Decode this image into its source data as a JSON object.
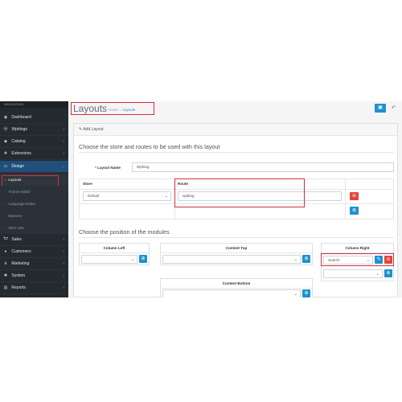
{
  "sidebar": {
    "header": "NAVIGATION",
    "items": [
      {
        "label": "Dashboard",
        "icon": "dashboard-icon",
        "glyph": "◉",
        "chev": ""
      },
      {
        "label": "Wpblogs",
        "icon": "wordpress-icon",
        "glyph": "Ⓦ",
        "chev": "›"
      },
      {
        "label": "Catalog",
        "icon": "tag-icon",
        "glyph": "◆",
        "chev": "›"
      },
      {
        "label": "Extensions",
        "icon": "puzzle-icon",
        "glyph": "✚",
        "chev": "›"
      },
      {
        "label": "Design",
        "icon": "monitor-icon",
        "glyph": "▭",
        "chev": "⌄"
      },
      {
        "label": "Sales",
        "icon": "cart-icon",
        "glyph": "🛒",
        "chev": "›"
      },
      {
        "label": "Customers",
        "icon": "user-icon",
        "glyph": "●",
        "chev": "›"
      },
      {
        "label": "Marketing",
        "icon": "share-icon",
        "glyph": "⋔",
        "chev": "›"
      },
      {
        "label": "System",
        "icon": "gear-icon",
        "glyph": "✱",
        "chev": "›"
      },
      {
        "label": "Reports",
        "icon": "bar-chart-icon",
        "glyph": "▥",
        "chev": "›"
      }
    ],
    "design_sub": [
      "Layouts",
      "Theme Editor",
      "Language Editor",
      "Banners",
      "SEO URL"
    ]
  },
  "page": {
    "title": "Layouts",
    "breadcrumb_home": "Home",
    "breadcrumb_sep": "›",
    "breadcrumb_current": "Layouts",
    "save_glyph": "▣",
    "back_glyph": "↶"
  },
  "panel": {
    "heading_glyph": "✎",
    "heading": "Add Layout",
    "section1": "Choose the store and routes to be used with this layout",
    "layout_name_req": "*",
    "layout_name_label": "Layout Name",
    "layout_name_value": "Wpblog",
    "store_header": "Store",
    "route_header": "Route",
    "store_value": "Default",
    "route_value": "wpblog",
    "section2": "Choose the position of the modules",
    "col_left": "Column Left",
    "content_top": "Content Top",
    "content_bottom": "Content Bottom",
    "col_right": "Column Right",
    "col_right_value": "Search",
    "remove_glyph": "⊖",
    "add_glyph": "⊕",
    "edit_glyph": "✎",
    "caret": "⌄"
  }
}
